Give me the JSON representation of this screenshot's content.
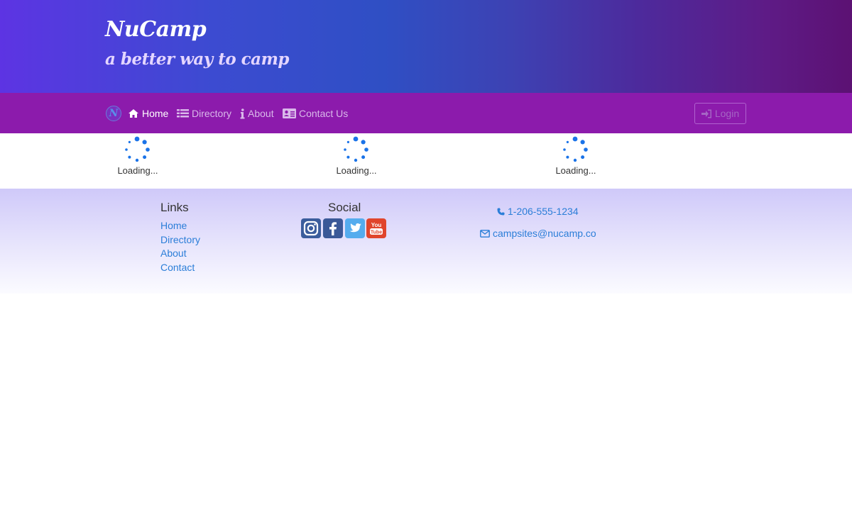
{
  "header": {
    "title": "NuCamp",
    "subtitle": "a better way to camp"
  },
  "nav": {
    "logo_letter": "N",
    "items": [
      {
        "label": "Home",
        "icon": "home-icon",
        "active": true
      },
      {
        "label": "Directory",
        "icon": "list-icon",
        "active": false
      },
      {
        "label": "About",
        "icon": "info-icon",
        "active": false
      },
      {
        "label": "Contact Us",
        "icon": "address-card-icon",
        "active": false
      }
    ],
    "login_label": "Login"
  },
  "loaders": [
    {
      "label": "Loading..."
    },
    {
      "label": "Loading..."
    },
    {
      "label": "Loading..."
    }
  ],
  "footer": {
    "links_heading": "Links",
    "links": [
      "Home",
      "Directory",
      "About",
      "Contact"
    ],
    "social_heading": "Social",
    "social": [
      "instagram-icon",
      "facebook-icon",
      "twitter-icon",
      "youtube-icon"
    ],
    "phone": "1-206-555-1234",
    "email": "campsites@nucamp.co"
  },
  "colors": {
    "navbar": "#8c1bac",
    "accent": "#2b7ed8",
    "spinner": "#1a73e8"
  }
}
